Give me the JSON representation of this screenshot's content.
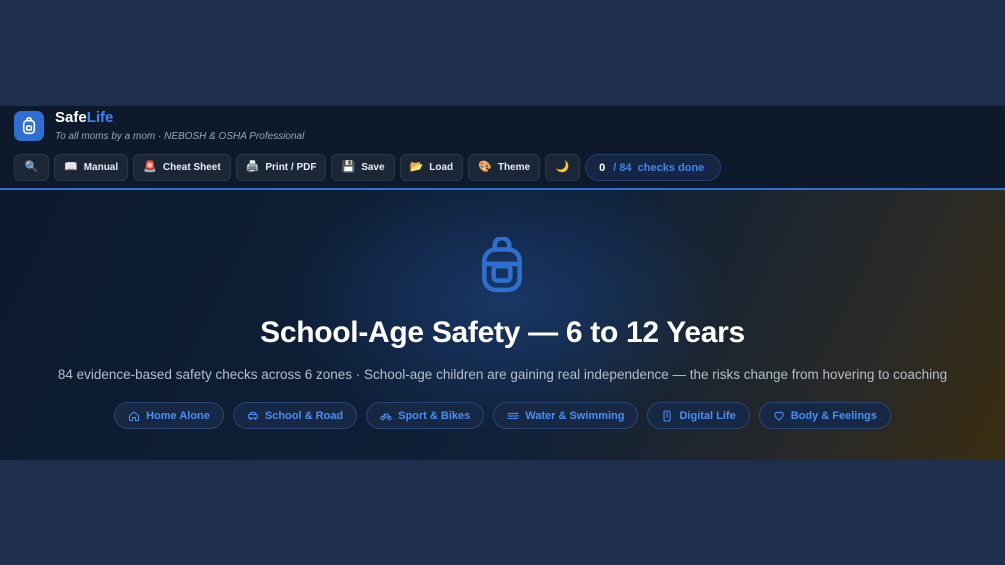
{
  "brand": {
    "name_part1": "Safe",
    "name_part2": "Life",
    "tagline": "To all moms by a mom · NEBOSH & OSHA Professional"
  },
  "toolbar": {
    "search_icon": "🔍",
    "buttons": [
      {
        "icon": "📖",
        "label": "Manual"
      },
      {
        "icon": "🚨",
        "label": "Cheat Sheet"
      },
      {
        "icon": "🖨️",
        "label": "Print / PDF"
      },
      {
        "icon": "💾",
        "label": "Save"
      },
      {
        "icon": "📂",
        "label": "Load"
      },
      {
        "icon": "🎨",
        "label": "Theme"
      }
    ],
    "dark_mode_icon": "🌙"
  },
  "progress": {
    "done": "0",
    "total_label": "/ 84  checks done"
  },
  "hero": {
    "icon": "backpack-icon",
    "title": "School-Age Safety — 6 to 12 Years",
    "subtitle": "84 evidence-based safety checks across 6 zones · School-age children are gaining real independence — the risks change from hovering to coaching"
  },
  "zones": [
    {
      "icon": "home-icon",
      "label": "Home Alone"
    },
    {
      "icon": "car-icon",
      "label": "School & Road"
    },
    {
      "icon": "bike-icon",
      "label": "Sport & Bikes"
    },
    {
      "icon": "waves-icon",
      "label": "Water & Swimming"
    },
    {
      "icon": "phone-icon",
      "label": "Digital Life"
    },
    {
      "icon": "heart-icon",
      "label": "Body & Feelings"
    }
  ],
  "colors": {
    "accent": "#3d86f0",
    "background": "#1e2e4d",
    "header": "#0e1a2c"
  }
}
